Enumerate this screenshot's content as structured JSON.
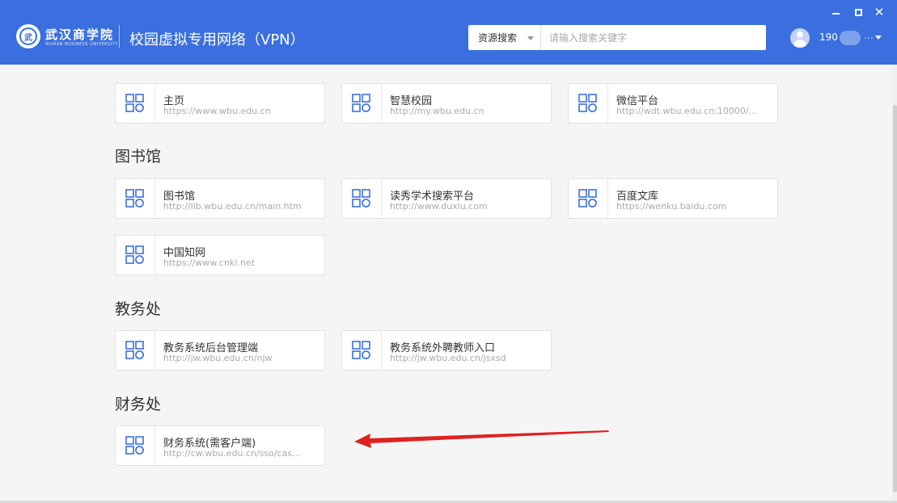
{
  "header": {
    "logo_glyph": "武",
    "school_name": "武汉商学院",
    "school_en": "WUHAN BUSINESS UNIVERSITY",
    "title": "校园虚拟专用网络（VPN）",
    "search": {
      "type_label": "资源搜索",
      "placeholder": "请输入搜索关键字"
    },
    "user": {
      "name_prefix": "190",
      "more": "...",
      "icon": "user-avatar-icon"
    },
    "window_controls": {
      "close_glyph": "✕"
    }
  },
  "sections": [
    {
      "title": "",
      "cards": [
        {
          "name": "主页",
          "url": "https://www.wbu.edu.cn"
        },
        {
          "name": "智慧校园",
          "url": "http://my.wbu.edu.cn"
        },
        {
          "name": "微信平台",
          "url": "http://wdt.wbu.edu.cn:10000/..."
        }
      ]
    },
    {
      "title": "图书馆",
      "cards": [
        {
          "name": "图书馆",
          "url": "http://lib.wbu.edu.cn/main.htm"
        },
        {
          "name": "读秀学术搜索平台",
          "url": "http://www.duxiu.com"
        },
        {
          "name": "百度文库",
          "url": "https://wenku.baidu.com"
        },
        {
          "name": "中国知网",
          "url": "https://www.cnki.net"
        }
      ]
    },
    {
      "title": "教务处",
      "cards": [
        {
          "name": "教务系统后台管理端",
          "url": "http://jw.wbu.edu.cn/njw"
        },
        {
          "name": "教务系统外聘教师入口",
          "url": "http://jw.wbu.edu.cn/jsxsd"
        }
      ]
    },
    {
      "title": "财务处",
      "cards": [
        {
          "name": "财务系统(需客户端)",
          "url": "http://cw.wbu.edu.cn/sso/cas..."
        }
      ]
    }
  ],
  "colors": {
    "header_bg": "#3b6fe0",
    "icon_blue": "#3b6fe0",
    "arrow_red": "#e02020"
  },
  "icons": {
    "card_icon": "app-grid-icon",
    "arrow": "red-arrow-annotation"
  }
}
